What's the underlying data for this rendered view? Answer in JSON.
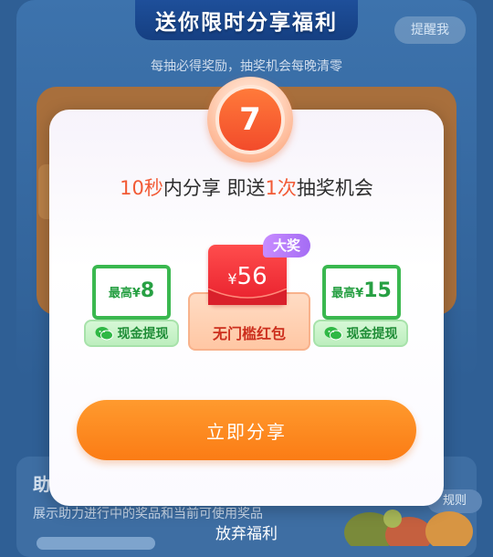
{
  "background": {
    "title": "送你限时分享福利",
    "remind_button": "提醒我",
    "subtitle": "每抽必得奖励，抽奖机会每晚清零",
    "section_heading": "助",
    "section_desc": "展示助力进行中的奖品和当前可使用奖品",
    "rules_button": "规则"
  },
  "modal": {
    "countdown": "7",
    "headline": {
      "part1": "10秒",
      "part2": "内分享  即送",
      "part3": "1次",
      "part4": "抽奖机会"
    },
    "rewards": [
      {
        "prefix": "最高",
        "currency": "¥",
        "amount": "8",
        "tag": "现金提现"
      },
      {
        "currency": "¥",
        "amount": "56",
        "label": "无门槛红包",
        "badge": "大奖"
      },
      {
        "prefix": "最高",
        "currency": "¥",
        "amount": "15",
        "tag": "现金提现"
      }
    ],
    "share_button": "立即分享",
    "abandon_link": "放弃福利"
  },
  "colors": {
    "accent_orange": "#fb7c15",
    "highlight_red": "#f25a35",
    "wechat_green": "#3ab84f",
    "packet_red": "#e81f2c",
    "badge_purple": "#a46cf4"
  }
}
